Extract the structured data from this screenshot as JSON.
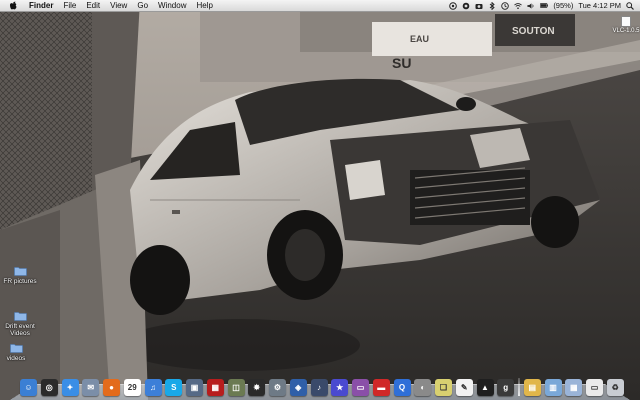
{
  "menubar": {
    "app_name": "Finder",
    "menus": [
      "File",
      "Edit",
      "View",
      "Go",
      "Window",
      "Help"
    ],
    "battery": "(95%)",
    "clock": "Tue 4:12 PM"
  },
  "desktop": {
    "icons": [
      {
        "label": "FR pictures"
      },
      {
        "label": "Drift event Videos"
      },
      {
        "label": "videos"
      }
    ],
    "volume": {
      "label": "VLC-1.0.5"
    }
  },
  "wallpaper": {
    "banner_text_1": "SOUTON",
    "banner_text_2": "SU",
    "banner_text_3": "EAU"
  },
  "dock": {
    "items": [
      {
        "name": "finder-dock-icon",
        "glyph": "☺",
        "color": "#3b7fd4"
      },
      {
        "name": "dashboard-dock-icon",
        "glyph": "◎",
        "color": "#2b2b2b"
      },
      {
        "name": "safari-dock-icon",
        "glyph": "✦",
        "color": "#3a8ee6"
      },
      {
        "name": "mail-dock-icon",
        "glyph": "✉",
        "color": "#7b8ea8"
      },
      {
        "name": "firefox-dock-icon",
        "glyph": "●",
        "color": "#e36b1c"
      },
      {
        "name": "ical-dock-icon",
        "glyph": "29",
        "color": "#ffffff"
      },
      {
        "name": "itunes-dock-icon",
        "glyph": "♫",
        "color": "#3c7fd8"
      },
      {
        "name": "skype-dock-icon",
        "glyph": "S",
        "color": "#19a8e8"
      },
      {
        "name": "iphoto-dock-icon",
        "glyph": "▣",
        "color": "#566a86"
      },
      {
        "name": "photo-booth-dock-icon",
        "glyph": "▦",
        "color": "#b71d1d"
      },
      {
        "name": "preview-dock-icon",
        "glyph": "◫",
        "color": "#6b7a52"
      },
      {
        "name": "photoshop-dock-icon",
        "glyph": "✸",
        "color": "#2a2a2a"
      },
      {
        "name": "utilities-dock-icon",
        "glyph": "⚙",
        "color": "#6e7a86"
      },
      {
        "name": "virtualbox-dock-icon",
        "glyph": "◈",
        "color": "#2f5fa8"
      },
      {
        "name": "garageband-dock-icon",
        "glyph": "♪",
        "color": "#3a4a6a"
      },
      {
        "name": "imovie-dock-icon",
        "glyph": "★",
        "color": "#4a4ad0"
      },
      {
        "name": "front-row-dock-icon",
        "glyph": "▭",
        "color": "#8a4fa8"
      },
      {
        "name": "iwork-dock-icon",
        "glyph": "▬",
        "color": "#d02828"
      },
      {
        "name": "quicktime-dock-icon",
        "glyph": "Q",
        "color": "#2f6fd8"
      },
      {
        "name": "system-prefs-dock-icon",
        "glyph": "◐",
        "color": "#8a8a8a"
      },
      {
        "name": "stickies-dock-icon",
        "glyph": "❏",
        "color": "#d8d070"
      },
      {
        "name": "pages-dock-icon",
        "glyph": "✎",
        "color": "#f2f2f2"
      },
      {
        "name": "app-store-dock-icon",
        "glyph": "▲",
        "color": "#1f1f1f"
      },
      {
        "name": "grapher-dock-icon",
        "glyph": "g",
        "color": "#3a3a3a"
      },
      {
        "name": "folder-dock-icon-1",
        "glyph": "▤",
        "color": "#e1b64a"
      },
      {
        "name": "documents-dock-icon",
        "glyph": "▥",
        "color": "#7aa8d8"
      },
      {
        "name": "downloads-dock-icon",
        "glyph": "▦",
        "color": "#9ab4d8"
      },
      {
        "name": "screenshots-dock-icon",
        "glyph": "▭",
        "color": "#eaeaea"
      },
      {
        "name": "trash-dock-icon",
        "glyph": "♻",
        "color": "#c8ccd2"
      }
    ]
  }
}
